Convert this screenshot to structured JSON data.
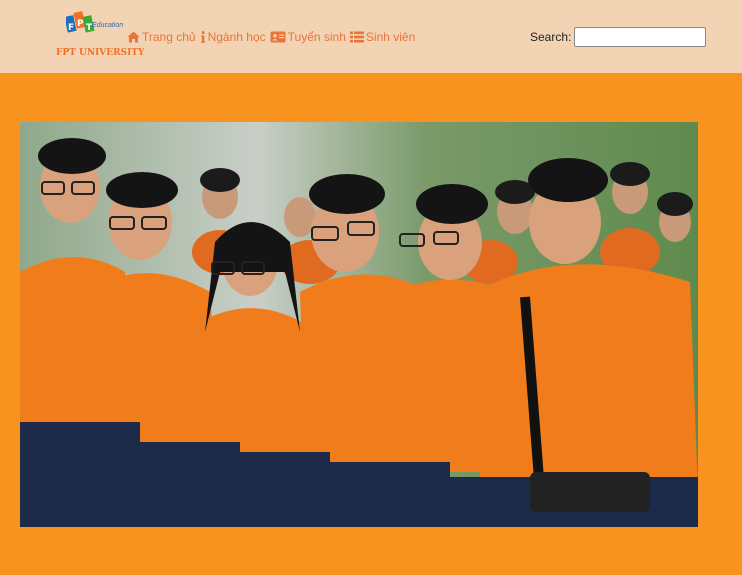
{
  "brand": {
    "logo_top": "FPT",
    "logo_sub": "Education",
    "name": "FPT UNIVERSITY"
  },
  "nav": {
    "items": [
      {
        "icon": "home-icon",
        "label": "Trang chủ"
      },
      {
        "icon": "info-icon",
        "label": "Ngành học"
      },
      {
        "icon": "id-card-icon",
        "label": "Tuyển sinh"
      },
      {
        "icon": "list-icon",
        "label": "Sinh viên"
      }
    ]
  },
  "search": {
    "label": "Search:",
    "value": "",
    "placeholder": ""
  },
  "hero": {
    "description_icon": "group-photo",
    "alt": ""
  },
  "colors": {
    "page_background": "#f7931e",
    "header_background": "#f2d4b4",
    "nav_text": "#e8743a",
    "brand_orange": "#f26f21"
  }
}
